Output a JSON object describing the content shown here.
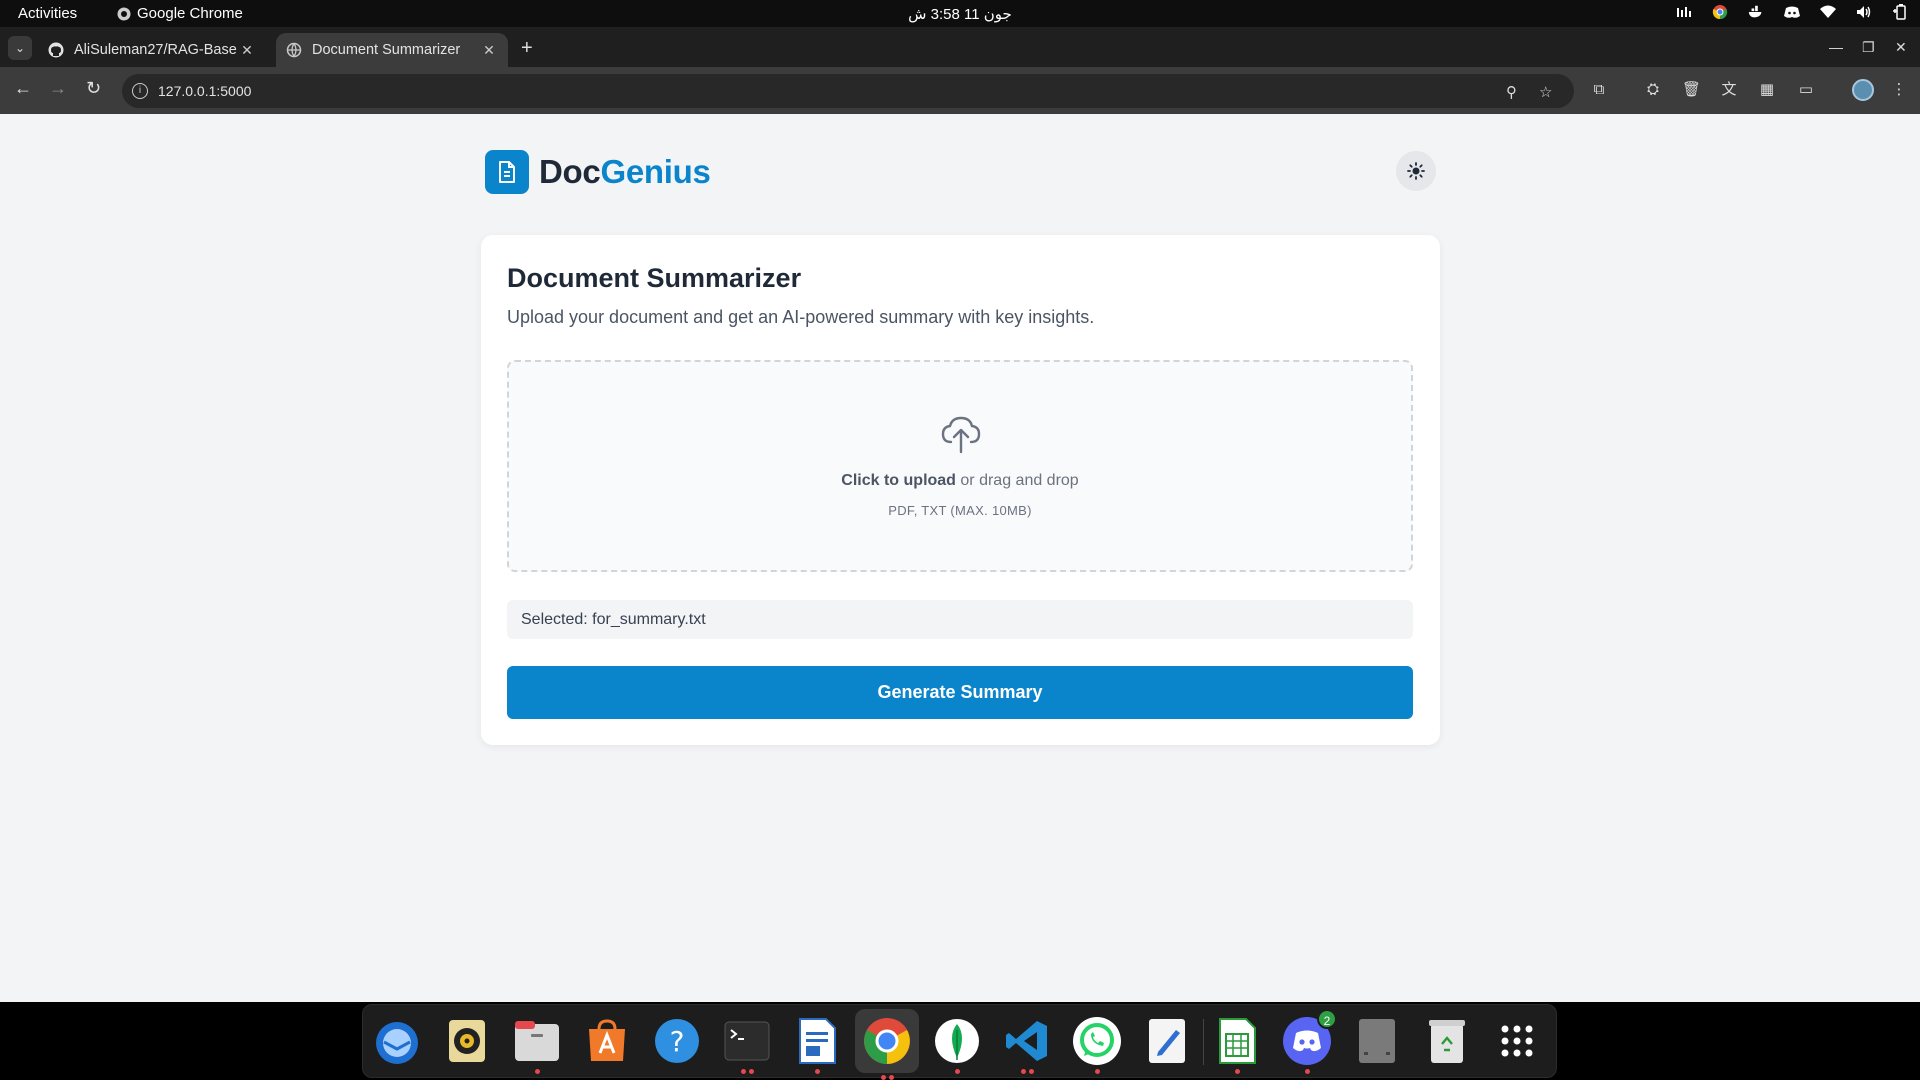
{
  "system": {
    "activities": "Activities",
    "app_name": "Google Chrome",
    "clock": "جون 11  3:58 ش"
  },
  "browser": {
    "tabs": [
      {
        "title": "AliSuleman27/RAG-Base",
        "icon": "github-icon",
        "active": false
      },
      {
        "title": "Document Summarizer",
        "icon": "globe-icon",
        "active": true
      }
    ],
    "url": "127.0.0.1:5000"
  },
  "app": {
    "brand_prefix": "Doc",
    "brand_accent": "Genius",
    "accent_color": "#0a85cc",
    "theme_icon": "sun-icon"
  },
  "card": {
    "title": "Document Summarizer",
    "subtitle": "Upload your document and get an AI-powered summary with key insights.",
    "upload_strong": "Click to upload",
    "upload_rest": " or drag and drop",
    "upload_hint": "PDF, TXT (MAX. 10MB)",
    "selected": "Selected: for_summary.txt",
    "button": "Generate Summary"
  },
  "dock": {
    "items": [
      "thunderbird-icon",
      "rhythmbox-icon",
      "files-icon",
      "app-center-icon",
      "help-icon",
      "terminal-icon",
      "libreoffice-writer-icon",
      "chrome-icon",
      "mongodb-compass-icon",
      "vscode-icon",
      "whatsapp-icon",
      "text-editor-icon",
      "libreoffice-calc-icon",
      "discord-icon",
      "drive-icon",
      "trash-icon",
      "app-grid-icon"
    ],
    "discord_badge": "2"
  }
}
